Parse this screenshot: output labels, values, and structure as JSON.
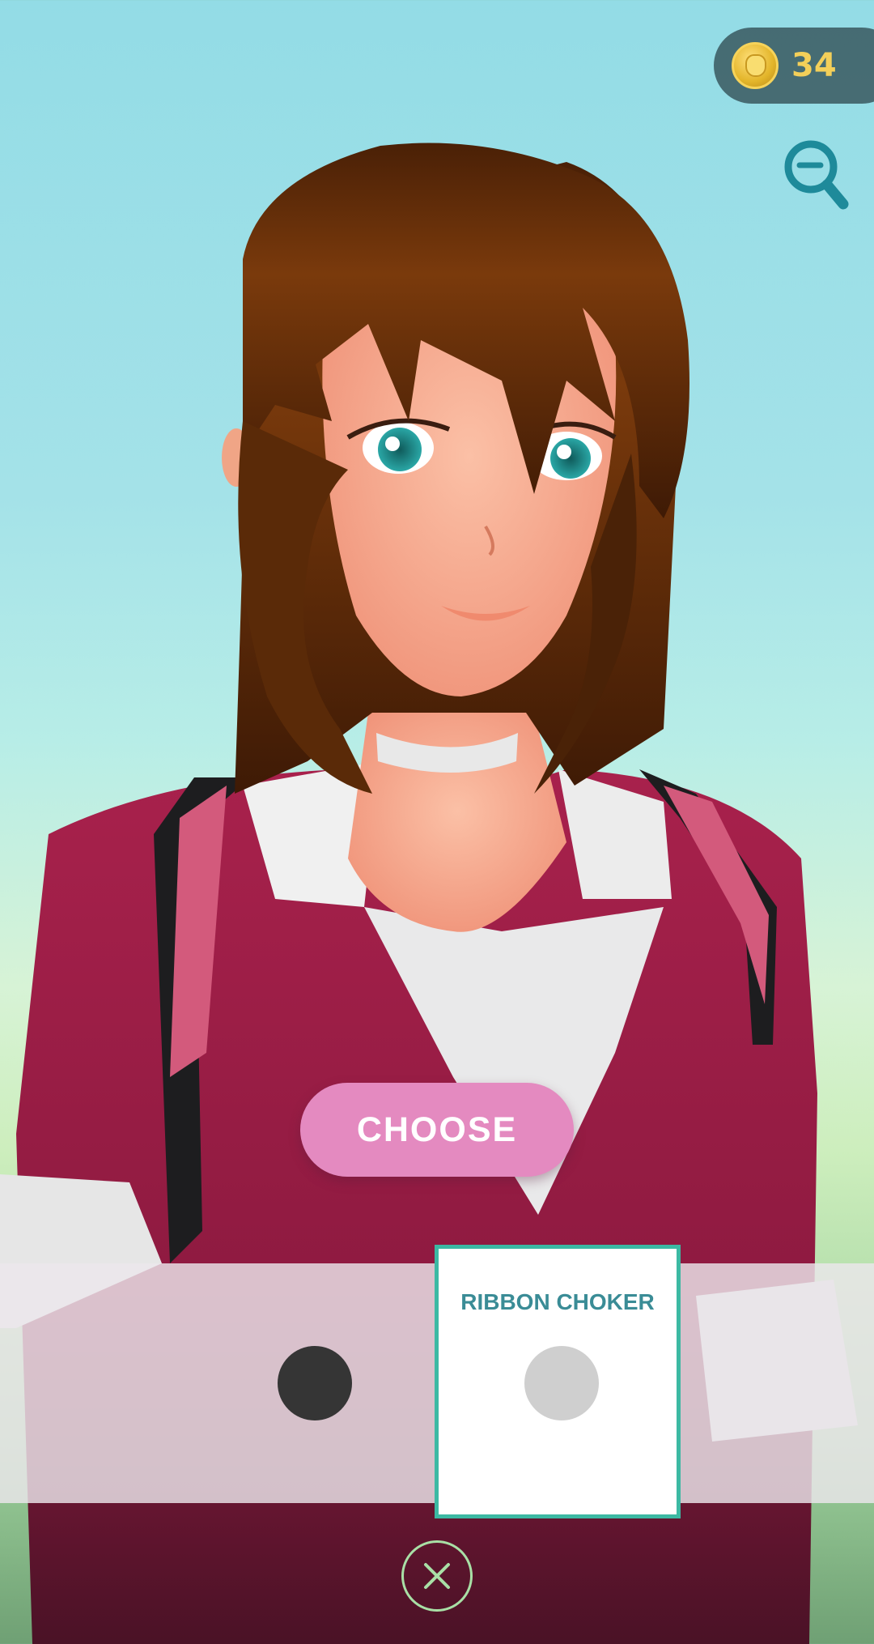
{
  "header": {
    "coin_icon": "pokecoin-icon",
    "coin_count": "34",
    "zoom_icon": "zoom-out-icon"
  },
  "choose_button": {
    "label": "CHOOSE"
  },
  "options": {
    "items": [
      {
        "type": "color-swatch",
        "color": "#353535",
        "selected": false
      },
      {
        "type": "color-swatch",
        "label": "RIBBON CHOKER",
        "color": "#cfcfcf",
        "selected": true
      }
    ],
    "selected_accent": "#3cb9a3"
  },
  "close_button": {
    "icon": "close-icon",
    "accent": "#a9e0a6"
  },
  "colors": {
    "button_pink": "#e48ac0",
    "jacket": "#9c1c44",
    "hair": "#5a2a08",
    "coin_text": "#f3cf59"
  }
}
